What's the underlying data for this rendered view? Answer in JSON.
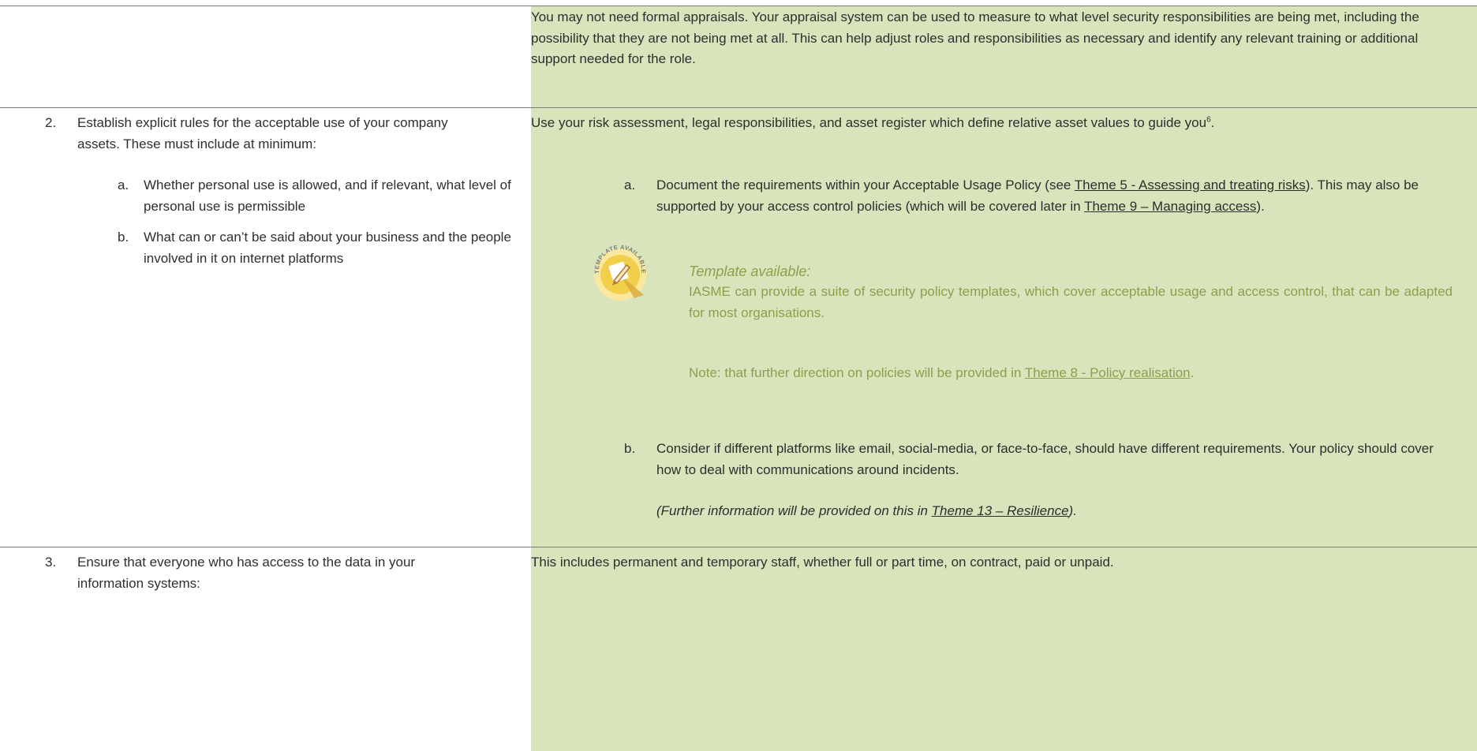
{
  "row1": {
    "guidance": "You may not need formal appraisals. Your appraisal system can be used to measure to what level security responsibilities are being met, including the possibility that they are not being met at all.  This can help adjust roles and responsibilities as necessary and identify any relevant training or additional support needed for the role."
  },
  "row2": {
    "number": "2.",
    "requirement": "Establish explicit rules for the acceptable use of your company assets. These must include at minimum:",
    "sub_items": [
      {
        "letter": "a.",
        "text": "Whether personal use is allowed, and if relevant, what level of personal use is permissible"
      },
      {
        "letter": "b.",
        "text": "What can or can’t be said about your business and the people involved in it on internet platforms"
      }
    ],
    "guidance_intro": "Use your risk assessment, legal responsibilities, and asset register which define relative asset values to guide you",
    "footnote_ref": "6",
    "guidance_intro_end": ".",
    "guidance_a": {
      "letter": "a.",
      "text_1": "Document the requirements within your Acceptable Usage Policy (see ",
      "link_1": "Theme 5 - Assessing and treating risks",
      "text_2": "). This may also be supported by your access control policies (which will be covered later in ",
      "link_2": "Theme 9 – Managing access",
      "text_3": ")."
    },
    "template_box": {
      "badge_text": "TEMPLATE AVAILABLE",
      "heading": "Template available:",
      "body": "IASME can provide a suite of security policy templates, which cover acceptable usage and access control, that can be adapted for most organisations.",
      "note_prefix": "Note: that further direction on policies will be provided in ",
      "note_link": "Theme 8 - Policy realisation",
      "note_suffix": "."
    },
    "guidance_b": {
      "letter": "b.",
      "text": "Consider if different platforms like email, social-media, or face-to-face, should have different requirements. Your policy should cover how to deal with communications around incidents.",
      "italic_prefix": "(Further information will be provided on this in ",
      "italic_link": "Theme 13 – Resilience",
      "italic_suffix": ")."
    }
  },
  "row3": {
    "number": "3.",
    "requirement": "Ensure that everyone who has access to the data in your information systems:",
    "guidance": "This includes permanent and temporary staff, whether full or part time, on contract, paid or unpaid."
  },
  "colors": {
    "green_fill": "#d8e4bc",
    "template_text": "#8aa14a",
    "badge": "#f2cf4a"
  }
}
